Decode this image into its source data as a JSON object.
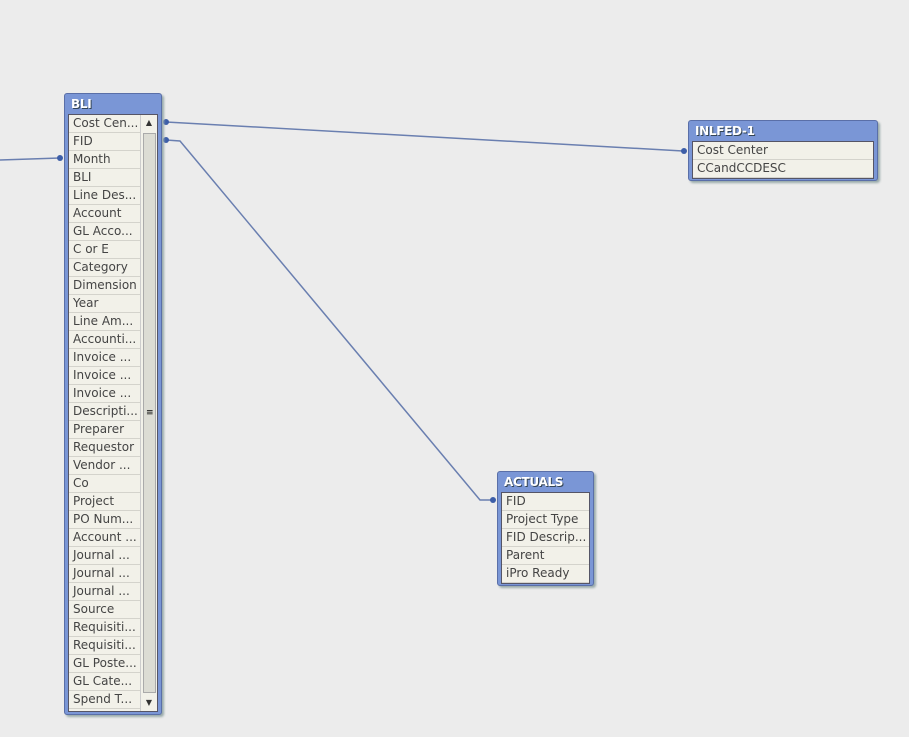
{
  "tables": {
    "bli": {
      "title": "BLI",
      "fields": [
        "Cost Cen...",
        "FID",
        "Month",
        "BLI",
        "Line Des...",
        "Account",
        "GL Acco...",
        "C or E",
        "Category",
        "Dimension",
        "Year",
        "Line Am...",
        "Accounti...",
        "Invoice ...",
        "Invoice ...",
        "Invoice ...",
        "Descripti...",
        "Preparer",
        "Requestor",
        "Vendor ...",
        "Co",
        "Project",
        "PO Num...",
        "Account ...",
        "Journal ...",
        "Journal ...",
        "Journal ...",
        "Source",
        "Requisiti...",
        "Requisiti...",
        "GL Poste...",
        "GL Cate...",
        "Spend T..."
      ]
    },
    "inlfed": {
      "title": "INLFED-1",
      "fields": [
        "Cost Center",
        "CCandCCDESC"
      ]
    },
    "actuals": {
      "title": "ACTUALS",
      "fields": [
        "FID",
        "Project Type",
        "FID Descrip...",
        "Parent",
        "iPro Ready"
      ]
    }
  },
  "colors": {
    "header": "#7a96d6",
    "link": "#6a7fb0",
    "background": "#ececec"
  }
}
